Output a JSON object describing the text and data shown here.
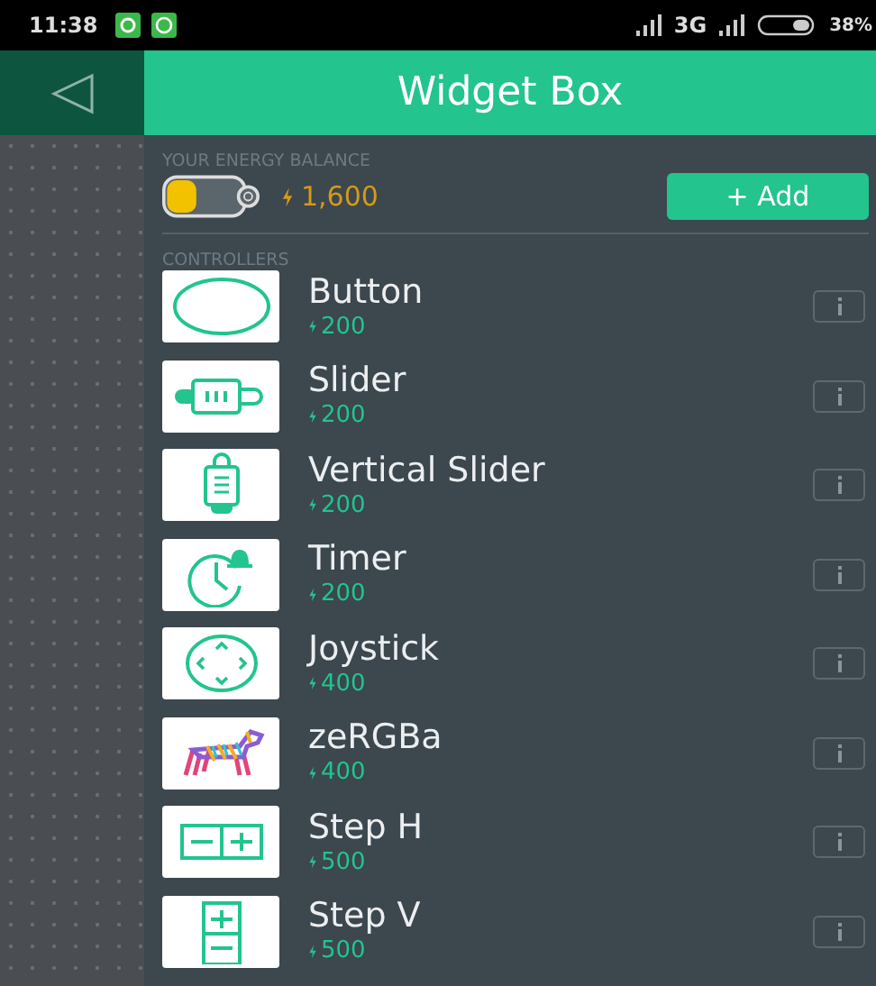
{
  "status_bar": {
    "time": "11:38",
    "network": "3G",
    "battery": "38%"
  },
  "header": {
    "title": "Widget Box"
  },
  "energy": {
    "label": "YOUR ENERGY BALANCE",
    "balance": "1,600",
    "add_button": "+ Add"
  },
  "section": {
    "label": "CONTROLLERS"
  },
  "widgets": [
    {
      "name": "Button",
      "price": "200",
      "kind": "button"
    },
    {
      "name": "Slider",
      "price": "200",
      "kind": "slider"
    },
    {
      "name": "Vertical Slider",
      "price": "200",
      "kind": "vslider"
    },
    {
      "name": "Timer",
      "price": "200",
      "kind": "timer"
    },
    {
      "name": "Joystick",
      "price": "400",
      "kind": "joystick"
    },
    {
      "name": "zeRGBa",
      "price": "400",
      "kind": "zergba"
    },
    {
      "name": "Step H",
      "price": "500",
      "kind": "steph"
    },
    {
      "name": "Step V",
      "price": "500",
      "kind": "stepv"
    }
  ]
}
